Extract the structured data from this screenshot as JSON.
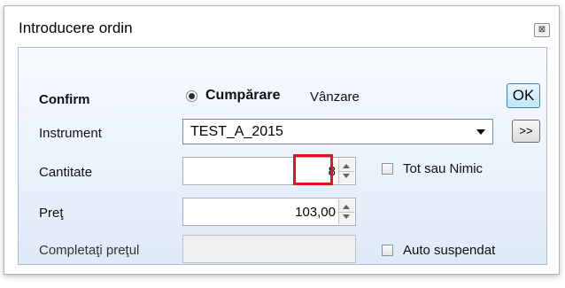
{
  "window": {
    "title": "Introducere ordin",
    "close_glyph": "⊠"
  },
  "form": {
    "confirm_label": "Confirm",
    "side_options": [
      {
        "label": "Cumpărare",
        "selected": true
      },
      {
        "label": "Vânzare",
        "selected": false
      }
    ],
    "ok_label": "OK",
    "instrument_label": "Instrument",
    "instrument_value": "TEST_A_2015",
    "more_label": ">>",
    "quantity_label": "Cantitate",
    "quantity_value": "8",
    "all_or_none_label": "Tot sau Nimic",
    "all_or_none_checked": false,
    "price_label": "Preţ",
    "price_value": "103,00",
    "complete_price_label": "Completaţi preţul",
    "complete_price_value": "",
    "auto_suspend_label": "Auto suspendat",
    "auto_suspend_checked": false
  },
  "colors": {
    "highlight": "#e01616",
    "panel_top": "#f7fbff",
    "panel_bottom": "#dfeaf7"
  }
}
